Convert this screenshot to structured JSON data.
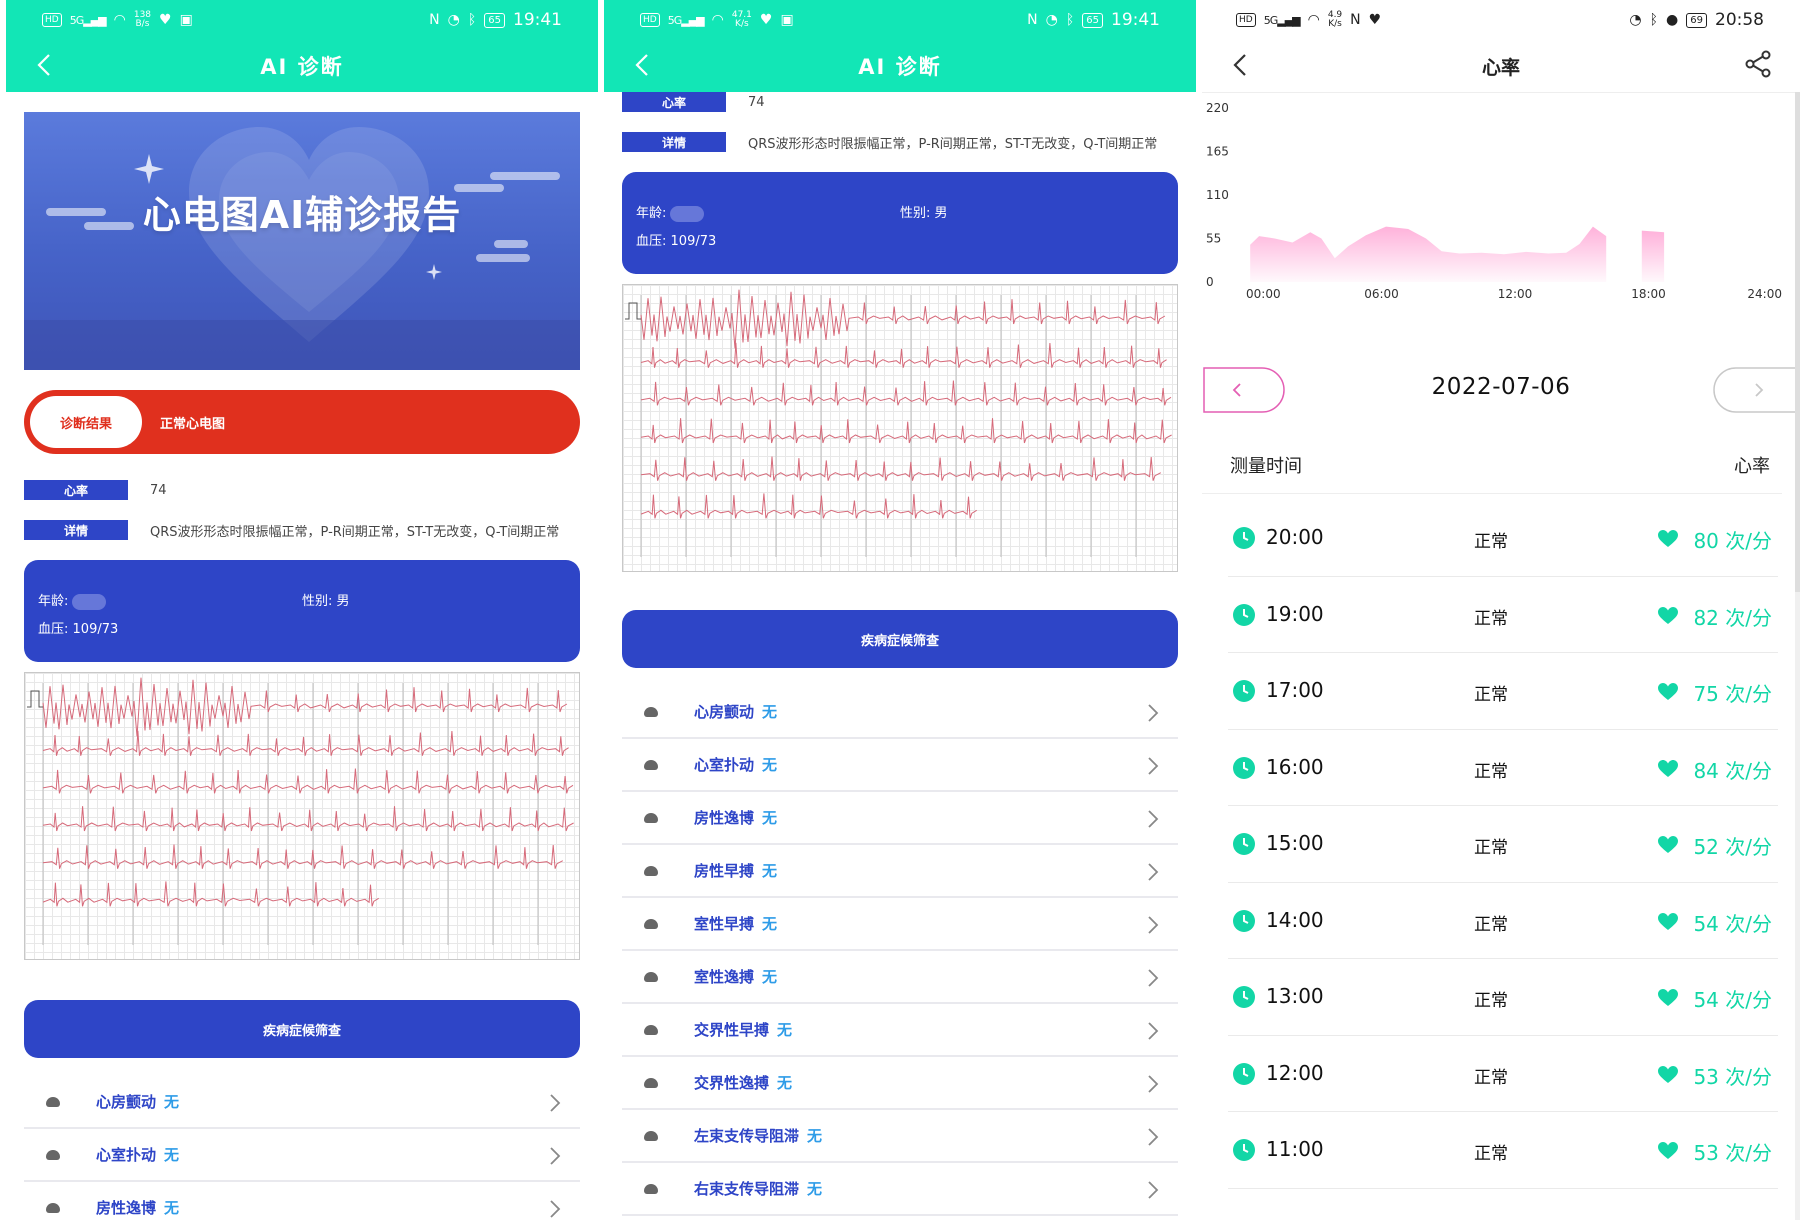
{
  "screen1": {
    "status": {
      "hd": "HD",
      "signal": "5G",
      "net_speed": "138",
      "net_unit": "B/s",
      "nfc": "N",
      "battery": "65",
      "clock": "19:41"
    },
    "header": {
      "title": "AI 诊断"
    },
    "banner": {
      "title": "心电图AI辅诊报告"
    },
    "diagnosis": {
      "label": "诊断结果",
      "value": "正常心电图"
    },
    "info": {
      "heart_rate_label": "心率",
      "heart_rate_value": "74",
      "detail_label": "详情",
      "detail_value": "QRS波形形态时限振幅正常，P-R间期正常，ST-T无改变，Q-T间期正常"
    },
    "patient": {
      "age_label": "年龄:",
      "gender_label": "性别:",
      "gender_value": "男",
      "bp_label": "血压:",
      "bp_value": "109/73"
    },
    "screening": {
      "button_label": "疾病症候筛查"
    },
    "diseases": [
      {
        "name": "心房颤动",
        "result": "无"
      },
      {
        "name": "心室扑动",
        "result": "无"
      },
      {
        "name": "房性逸博",
        "result": "无"
      }
    ]
  },
  "screen2": {
    "status": {
      "hd": "HD",
      "signal": "5G",
      "net_speed": "47.1",
      "net_unit": "K/s",
      "nfc": "N",
      "battery": "65",
      "clock": "19:41"
    },
    "header": {
      "title": "AI 诊断"
    },
    "info": {
      "heart_rate_label": "心率",
      "heart_rate_value": "74",
      "detail_label": "详情",
      "detail_value": "QRS波形形态时限振幅正常，P-R间期正常，ST-T无改变，Q-T间期正常"
    },
    "patient": {
      "age_label": "年龄:",
      "gender_label": "性别:",
      "gender_value": "男",
      "bp_label": "血压:",
      "bp_value": "109/73"
    },
    "screening": {
      "button_label": "疾病症候筛查"
    },
    "diseases": [
      {
        "name": "心房颤动",
        "result": "无"
      },
      {
        "name": "心室扑动",
        "result": "无"
      },
      {
        "name": "房性逸博",
        "result": "无"
      },
      {
        "name": "房性早搏",
        "result": "无"
      },
      {
        "name": "室性早搏",
        "result": "无"
      },
      {
        "name": "室性逸搏",
        "result": "无"
      },
      {
        "name": "交界性早搏",
        "result": "无"
      },
      {
        "name": "交界性逸搏",
        "result": "无"
      },
      {
        "name": "左束支传导阻滞",
        "result": "无"
      },
      {
        "name": "右束支传导阻滞",
        "result": "无"
      }
    ]
  },
  "screen3": {
    "status": {
      "hd": "HD",
      "signal": "5G",
      "net_speed": "4.9",
      "net_unit": "K/s",
      "nfc": "N",
      "battery": "69",
      "clock": "20:58"
    },
    "header": {
      "title": "心率"
    },
    "chart_data": {
      "type": "area",
      "y_ticks": [
        "220",
        "165",
        "110",
        "55",
        "0"
      ],
      "x_ticks": [
        "00:00",
        "06:00",
        "12:00",
        "18:00",
        "24:00"
      ],
      "ylim": [
        0,
        220
      ],
      "xlim": [
        0,
        24
      ],
      "color": "#ffaed9",
      "series": [
        {
          "x": [
            0.1,
            0.5,
            1.2,
            2.0,
            2.8,
            3.3,
            3.9,
            4.5,
            5.3,
            6.2,
            7.2,
            8.0,
            8.7,
            9.5,
            10.5,
            11.5,
            12.5,
            13.5,
            14.3,
            14.9,
            15.5,
            15.9,
            16.1
          ],
          "y": [
            47,
            58,
            55,
            50,
            63,
            55,
            30,
            45,
            59,
            70,
            67,
            55,
            39,
            36,
            37,
            35,
            38,
            36,
            37,
            48,
            70,
            62,
            58
          ]
        },
        {
          "x": [
            17.7,
            18.7
          ],
          "y": [
            65,
            63
          ]
        }
      ]
    },
    "date_nav": {
      "date": "2022-07-06",
      "prev_color": "#e45fb4",
      "next_color": "#c8c8c8"
    },
    "list_header": {
      "time_col": "测量时间",
      "rate_col": "心率"
    },
    "records": [
      {
        "time": "20:00",
        "status": "正常",
        "bpm": "80 次/分"
      },
      {
        "time": "19:00",
        "status": "正常",
        "bpm": "82 次/分"
      },
      {
        "time": "17:00",
        "status": "正常",
        "bpm": "75 次/分"
      },
      {
        "time": "16:00",
        "status": "正常",
        "bpm": "84 次/分"
      },
      {
        "time": "15:00",
        "status": "正常",
        "bpm": "52 次/分"
      },
      {
        "time": "14:00",
        "status": "正常",
        "bpm": "54 次/分"
      },
      {
        "time": "13:00",
        "status": "正常",
        "bpm": "54 次/分"
      },
      {
        "time": "12:00",
        "status": "正常",
        "bpm": "53 次/分"
      },
      {
        "time": "11:00",
        "status": "正常",
        "bpm": "53 次/分"
      }
    ]
  },
  "theme": {
    "accent_green": "#12e6b6",
    "brand_blue": "#2e45c7",
    "diag_red": "#e0301e",
    "rate_green": "#12d6a6",
    "chart_pink": "#ffaed9"
  },
  "icons": [
    "back-arrow-icon",
    "share-icon",
    "chevron-right-icon",
    "clock-icon",
    "heart-icon",
    "wifi-icon",
    "bluetooth-icon",
    "alarm-icon"
  ]
}
